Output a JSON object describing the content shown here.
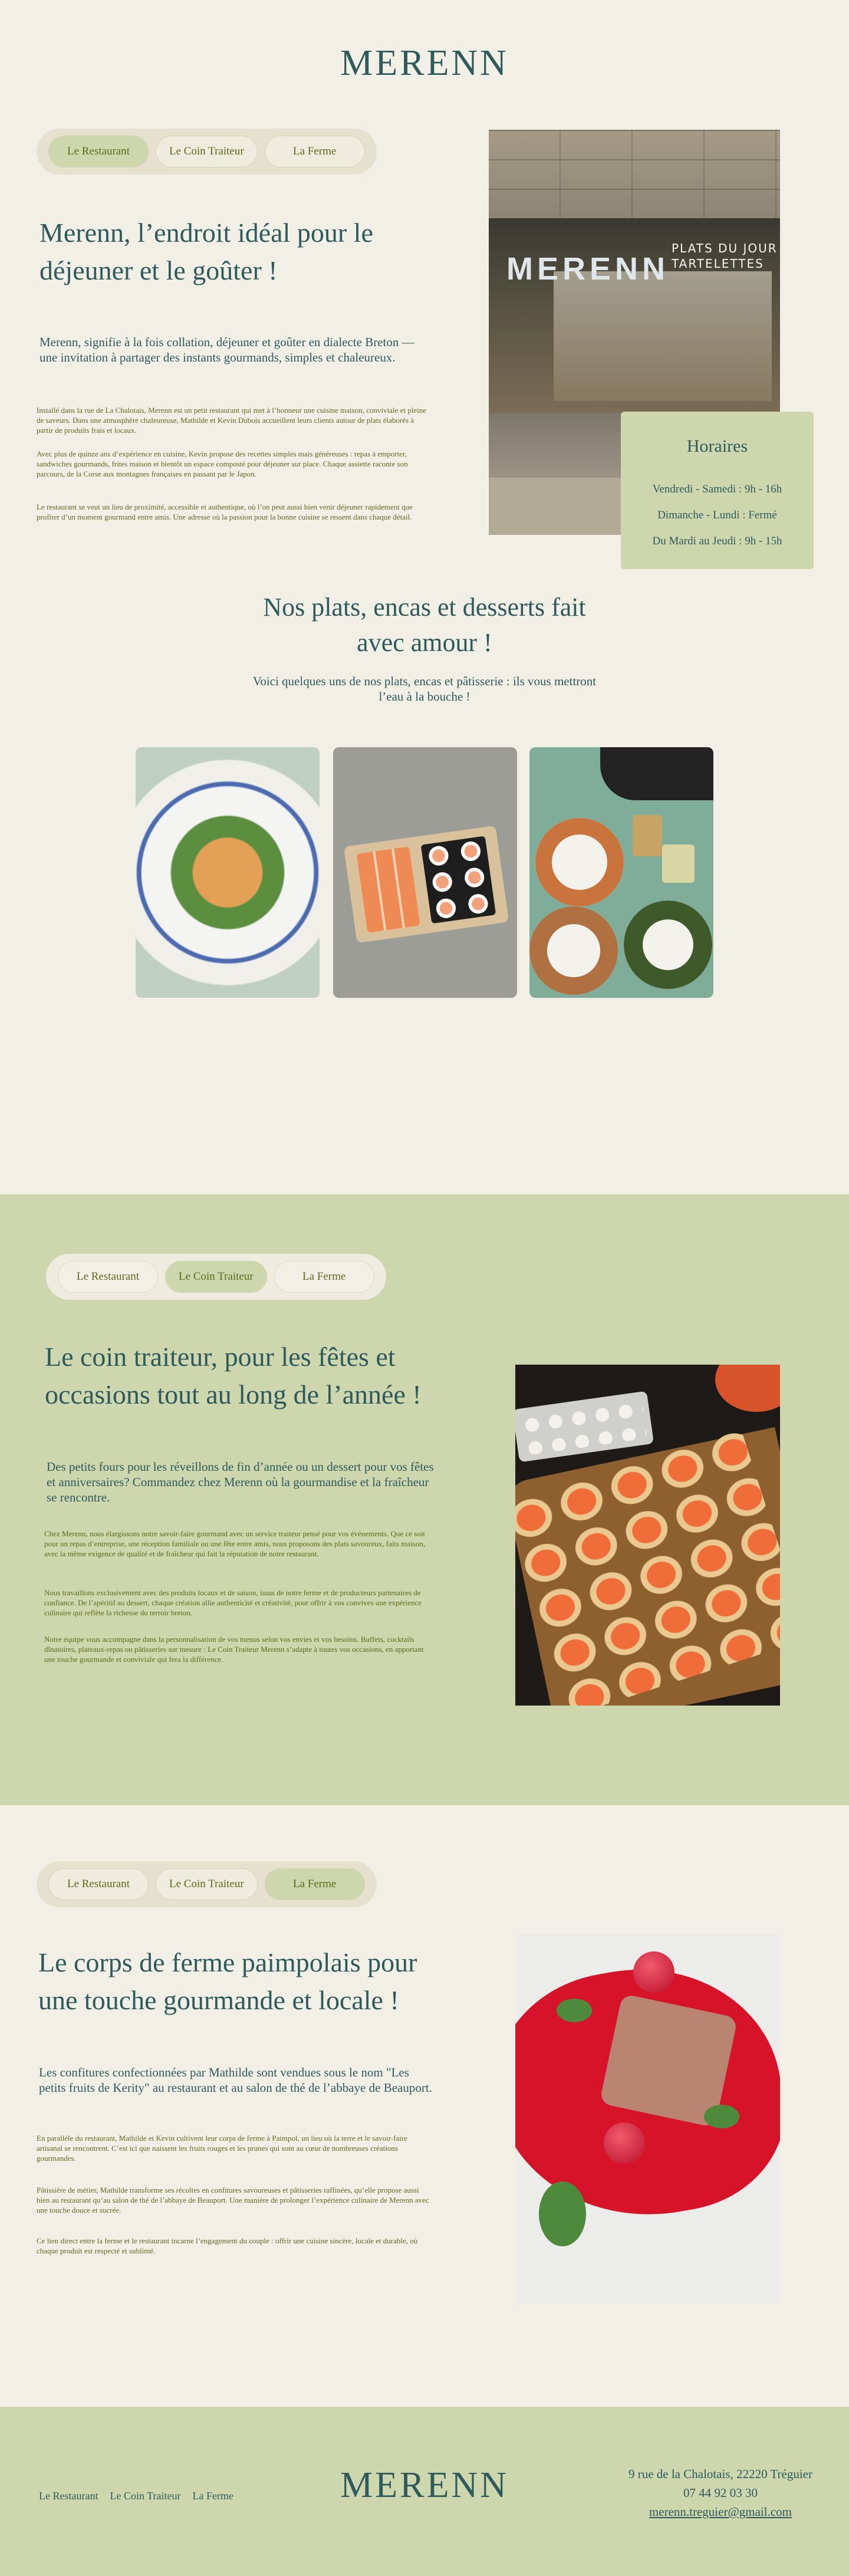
{
  "brand": {
    "logo": "MERENN"
  },
  "tabs": [
    "Le Restaurant",
    "Le Coin Traiteur",
    "La Ferme"
  ],
  "restaurant": {
    "active_tab": "Le Restaurant",
    "title": "Merenn, l’endroit idéal pour le déjeuner et le goûter !",
    "lead": "Merenn, signifie à la fois collation, déjeuner et goûter en dialecte Breton — une invitation à partager des instants gourmands, simples et chaleureux.",
    "paragraphs": [
      "Installé dans la rue de La Chalotais, Merenn est un petit restaurant qui met à l’honneur une cuisine maison, conviviale et pleine de saveurs. Dans une atmosphère chaleureuse, Mathilde et Kevin Dubois accueillent leurs clients autour de plats élaborés à partir de produits frais et locaux.",
      "Avec plus de quinze ans d’expérience en cuisine, Kevin propose des recettes simples mais généreuses : repas à emporter, sandwiches gourmands, frites maison et bientôt un espace composté pour déjeuner sur place. Chaque assiette raconte son parcours, de la Corse aux montagnes françaises en passant par le Japon.",
      "Le restaurant se veut un lieu de proximité, accessible et authentique, où l’on peut aussi bien venir déjeuner rapidement que profiter d’un moment gourmand entre amis. Une adresse où la passion pour la bonne cuisine se ressent dans chaque détail."
    ],
    "storefront_sign": "MERENN",
    "storefront_board": "PLATS DU JOUR\nTARTELETTES"
  },
  "hours": {
    "title": "Horaires",
    "lines": [
      "Vendredi - Samedi : 9h - 16h",
      "Dimanche - Lundi : Fermé",
      "Du Mardi au Jeudi : 9h - 15h"
    ]
  },
  "dishes": {
    "title": "Nos plats, encas et desserts fait avec amour !",
    "subtitle": "Voici quelques uns de nos plats, encas et pâtisserie : ils vous mettront l’eau à la bouche !"
  },
  "traiteur": {
    "active_tab": "Le Coin Traiteur",
    "title": "Le coin traiteur, pour les fêtes et occasions tout au long de l’année !",
    "lead": "Des petits fours pour les réveillons de fin d’année ou un dessert pour vos fêtes et anniversaires? Commandez chez Merenn où la gourmandise et la fraîcheur se rencontre.",
    "paragraphs": [
      "Chez Merenn, nous élargissons notre savoir-faire gourmand avec un service traiteur pensé pour vos événements. Que ce soit pour un repas d’entreprise, une réception familiale ou une fête entre amis, nous proposons des plats savoureux, faits maison, avec la même exigence de qualité et de fraîcheur qui fait la réputation de notre restaurant.",
      "Nous travaillons exclusivement avec des produits locaux et de saison, issus de notre ferme et de producteurs partenaires de confiance. De l’apéritif au dessert, chaque création allie authenticité et créativité, pour offrir à vos convives une expérience culinaire qui reflète la richesse du terroir breton.",
      "Notre équipe vous accompagne dans la personnalisation de vos menus selon vos envies et vos besoins. Buffets, cocktails dînatoires, plateaux-repas ou pâtisseries sur mesure : Le Coin Traiteur Merenn s’adapte à toutes vos occasions, en apportant une touche gourmande et conviviale qui fera la différence."
    ]
  },
  "ferme": {
    "active_tab": "La Ferme",
    "title": "Le corps de ferme paimpolais pour une touche gourmande et locale !",
    "lead": "Les confitures confectionnées par Mathilde sont vendues sous le nom \"Les petits fruits de Kerity\" au restaurant et au salon de thé de l’abbaye de Beauport.",
    "paragraphs": [
      "En parallèle du restaurant, Mathilde et Kevin cultivent leur corps de ferme à Paimpol, un lieu où la terre et le savoir-faire artisanal se rencontrent. C’est ici que naissent les fruits rouges et les prunes qui sont au cœur de nombreuses créations gourmandes.",
      "Pâtissière de métier, Mathilde transforme ses récoltes en confitures savoureuses et pâtisseries raffinées, qu’elle propose aussi bien au restaurant qu’au salon de thé de l’abbaye de Beauport. Une manière de prolonger l’expérience culinaire de Merenn avec une touche douce et sucrée.",
      "Ce lien direct entre la ferme et le restaurant incarne l’engagement du couple : offrir une cuisine sincère, locale et durable, où chaque produit est respecté et sublimé."
    ]
  },
  "footer": {
    "nav": [
      "Le Restaurant",
      "Le Coin Traiteur",
      "La Ferme"
    ],
    "logo": "MERENN",
    "address": "9 rue de la Chalotais, 22220 Tréguier",
    "phone": "07 44 92 03 30",
    "email": "merenn.treguier@gmail.com"
  }
}
